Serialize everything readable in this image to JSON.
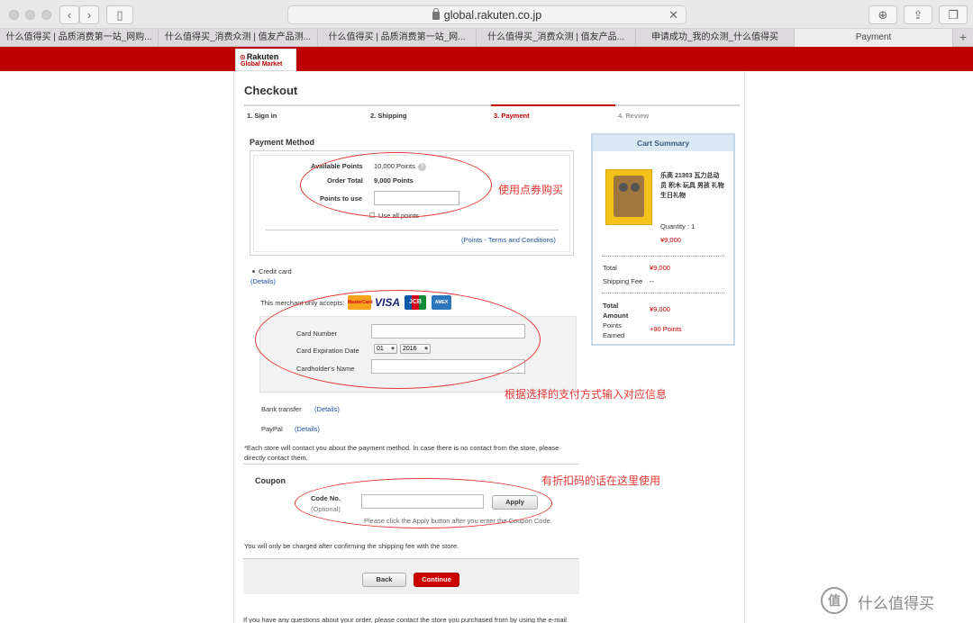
{
  "browser": {
    "url": "global.rakuten.co.jp",
    "tabs": [
      "什么值得买 | 品质消费第一站_网购...",
      "什么值得买_消费众测 | 值友产品测...",
      "什么值得买 | 品质消费第一站_网...",
      "什么值得买_消费众测 | 值友产品...",
      "申请成功_我的众测_什么值得买",
      "Payment"
    ],
    "add_tab": "+",
    "clear": "✕"
  },
  "brand": {
    "line1": "Rakuten",
    "line2": "Global Market"
  },
  "checkout": {
    "title": "Checkout",
    "steps": [
      "1. Sign in",
      "2. Shipping",
      "3. Payment",
      "4. Review"
    ]
  },
  "payment_method": {
    "heading": "Payment Method",
    "available_points_label": "Available Points",
    "available_points_value": "10,000 Points",
    "help": "?",
    "order_total_label": "Order Total",
    "order_total_value": "9,000 Points",
    "points_to_use_label": "Points to use",
    "points_to_use_value": "",
    "use_all_label": "Use all points",
    "terms_link": "(Points - Terms and Conditions)"
  },
  "credit_card": {
    "label": "Credit card",
    "details": "(Details)",
    "accepts": "This merchant only accepts:",
    "logos": [
      "MasterCard",
      "VISA",
      "JCB",
      "AMEX"
    ],
    "card_number_label": "Card Number",
    "expiration_label": "Card Expiration Date",
    "exp_month": "01",
    "exp_year": "2016",
    "holder_label": "Cardholder's Name"
  },
  "bank_transfer": {
    "label": "Bank transfer",
    "details": "(Details)"
  },
  "paypal": {
    "label": "PayPal",
    "details": "(Details)"
  },
  "store_note": "*Each store will contact you about the payment method. In case there is no contact from the store, please directly contact them.",
  "coupon": {
    "heading": "Coupon",
    "code_label": "Code No.",
    "optional": "(Optional)",
    "apply": "Apply",
    "hint": "Please click the Apply button after you enter the Coupon Code."
  },
  "charge_note": "You will only be charged after confirming the shipping fee with the store.",
  "buttons": {
    "back": "Back",
    "continue": "Continue"
  },
  "bottom_text": "If you have any questions about your order, please contact the store you purchased from by using the e-mail",
  "cart": {
    "title": "Cart Summary",
    "product_name": "乐高 21303 瓦力总动员 积木 玩具 男孩 礼物 生日礼物",
    "quantity": "Quantity : 1",
    "price": "¥9,000",
    "total_label": "Total",
    "total_value": "¥9,000",
    "shipping_label": "Shipping Fee",
    "shipping_value": "--",
    "total_amount_label": "Total Amount",
    "total_amount_value": "¥9,000",
    "points_earned_label": "Points Earned",
    "points_earned_value": "+90 Points"
  },
  "annotations": {
    "points": "使用点券购买",
    "payment": "根据选择的支付方式输入对应信息",
    "coupon": "有折扣码的话在这里使用"
  },
  "watermark": {
    "icon": "值",
    "text": "什么值得买"
  },
  "colors": {
    "brand_red": "#bf0000",
    "annotation_red": "#e53935",
    "link_blue": "#1a4f9c"
  }
}
